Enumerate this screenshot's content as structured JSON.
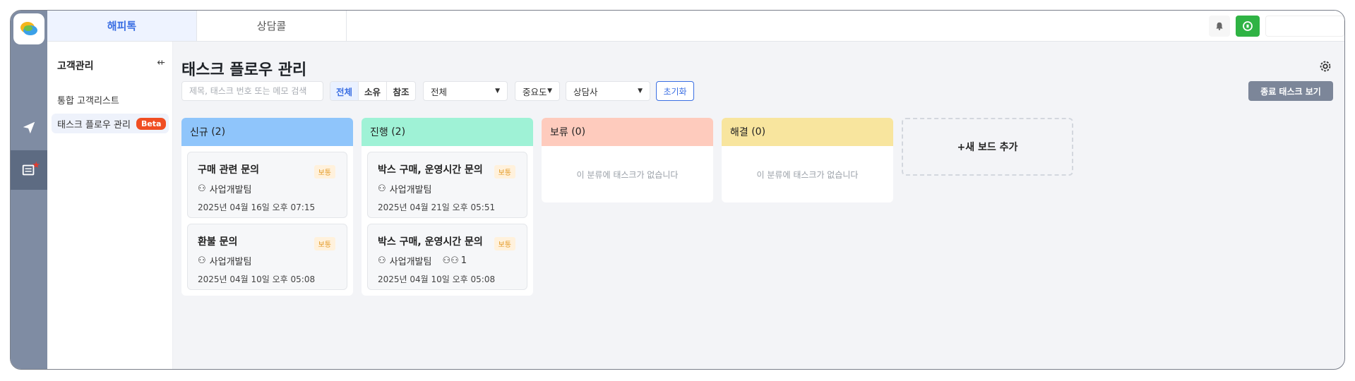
{
  "app": {
    "brand_colors": {
      "accent": "#3b6fe3",
      "rail": "#7f8ca3",
      "green": "#2fb344",
      "beta": "#f04e23"
    }
  },
  "top_tabs": [
    {
      "label": "해피톡",
      "active": true
    },
    {
      "label": "상담콜",
      "active": false
    }
  ],
  "sidebar": {
    "title": "고객관리",
    "items": [
      {
        "label": "통합 고객리스트",
        "active": false
      },
      {
        "label": "태스크 플로우 관리",
        "active": true,
        "badge": "Beta"
      }
    ]
  },
  "main": {
    "title": "태스크 플로우 관리",
    "search_placeholder": "제목, 태스크 번호 또는 메모 검색",
    "segments": [
      {
        "label": "전체",
        "on": true
      },
      {
        "label": "소유",
        "on": false
      },
      {
        "label": "참조",
        "on": false
      }
    ],
    "filter_status": "전체",
    "filter_priority": "중요도",
    "filter_agent": "상담사",
    "reset_label": "초기화",
    "closed_tasks_label": "종료 태스크 보기",
    "new_board_label": "+새 보드 추가",
    "empty_text": "이 분류에 태스크가 없습니다"
  },
  "columns": [
    {
      "name": "신규",
      "count": "(2)",
      "color": "#8fc5fb",
      "cards": [
        {
          "title": "구매 관련 문의",
          "priority": "보통",
          "team": "사업개발팀",
          "date": "2025년 04월 16일 오후 07:15",
          "people": ""
        },
        {
          "title": "환불 문의",
          "priority": "보통",
          "team": "사업개발팀",
          "date": "2025년 04월 10일 오후 05:08",
          "people": ""
        }
      ]
    },
    {
      "name": "진행",
      "count": "(2)",
      "color": "#9ff2d6",
      "cards": [
        {
          "title": "박스 구매, 운영시간 문의",
          "priority": "보통",
          "team": "사업개발팀",
          "date": "2025년 04월 21일 오후 05:51",
          "people": ""
        },
        {
          "title": "박스 구매, 운영시간 문의",
          "priority": "보통",
          "team": "사업개발팀",
          "date": "2025년 04월 10일 오후 05:08",
          "people": "1"
        }
      ]
    },
    {
      "name": "보류",
      "count": "(0)",
      "color": "#fecbbd",
      "cards": []
    },
    {
      "name": "해결",
      "count": "(0)",
      "color": "#f8e59e",
      "cards": []
    }
  ]
}
